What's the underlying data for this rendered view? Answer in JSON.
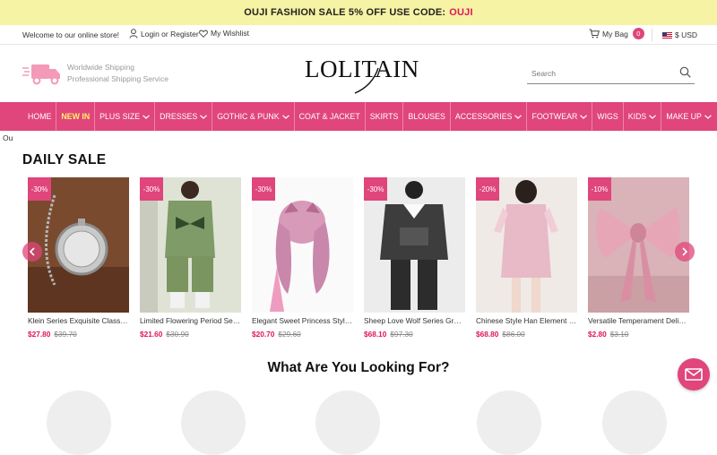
{
  "promo": {
    "text": "OUJI FASHION SALE 5% OFF USE CODE:",
    "code": "OUJI"
  },
  "topbar": {
    "welcome": "Welcome to our online store!",
    "login": "Login or Register",
    "wishlist": "My Wishlist",
    "bag": "My Bag",
    "bag_count": "0",
    "currency": "$ USD"
  },
  "header": {
    "shipping_line1": "Worldwide Shipping",
    "shipping_line2": "Professional Shipping Service",
    "logo": "LOLITAIN",
    "search_placeholder": "Search"
  },
  "nav": [
    {
      "label": "HOME",
      "dropdown": false,
      "highlight": false
    },
    {
      "label": "NEW IN",
      "dropdown": false,
      "highlight": true
    },
    {
      "label": "PLUS SIZE",
      "dropdown": true,
      "highlight": false
    },
    {
      "label": "DRESSES",
      "dropdown": true,
      "highlight": false
    },
    {
      "label": "GOTHIC & PUNK",
      "dropdown": true,
      "highlight": false
    },
    {
      "label": "COAT & JACKET",
      "dropdown": false,
      "highlight": false
    },
    {
      "label": "SKIRTS",
      "dropdown": false,
      "highlight": false
    },
    {
      "label": "BLOUSES",
      "dropdown": false,
      "highlight": false
    },
    {
      "label": "ACCESSORIES",
      "dropdown": true,
      "highlight": false
    },
    {
      "label": "FOOTWEAR",
      "dropdown": true,
      "highlight": false
    },
    {
      "label": "WIGS",
      "dropdown": false,
      "highlight": false
    },
    {
      "label": "KIDS",
      "dropdown": true,
      "highlight": false
    },
    {
      "label": "MAKE UP",
      "dropdown": true,
      "highlight": false
    }
  ],
  "stray_text": "Ou",
  "daily_sale": {
    "title": "DAILY SALE",
    "products": [
      {
        "discount": "-30%",
        "name": "Klein Series Exquisite Classic Retro Pocket Watch",
        "price": "$27.80",
        "old_price": "$39.70",
        "image": "pocket-watch-photo"
      },
      {
        "discount": "-30%",
        "name": "Limited Flowering Period Series Ouji Set",
        "price": "$21.60",
        "old_price": "$30.90",
        "image": "green-ouji-outfit-photo"
      },
      {
        "discount": "-30%",
        "name": "Elegant Sweet Princess Style Synthetic Wig",
        "price": "$20.70",
        "old_price": "$29.60",
        "image": "pink-wig-photo"
      },
      {
        "discount": "-30%",
        "name": "Sheep Love Wolf Series Gray Pants Set",
        "price": "$68.10",
        "old_price": "$97.30",
        "image": "gray-hoodie-outfit-photo"
      },
      {
        "discount": "-20%",
        "name": "Chinese Style Han Element Improved Qipao Dress",
        "price": "$68.80",
        "old_price": "$86.00",
        "image": "pink-qipao-dress-photo"
      },
      {
        "discount": "-10%",
        "name": "Versatile Temperament Delicate Bow Hairpin",
        "price": "$2.80",
        "old_price": "$3.10",
        "image": "pink-bow-photo"
      }
    ]
  },
  "looking_title": "What Are You Looking For?",
  "colors": {
    "accent": "#e0457b",
    "promo_bg": "#f6f3a4",
    "price": "#e0145a",
    "nav_highlight": "#fff36b"
  }
}
